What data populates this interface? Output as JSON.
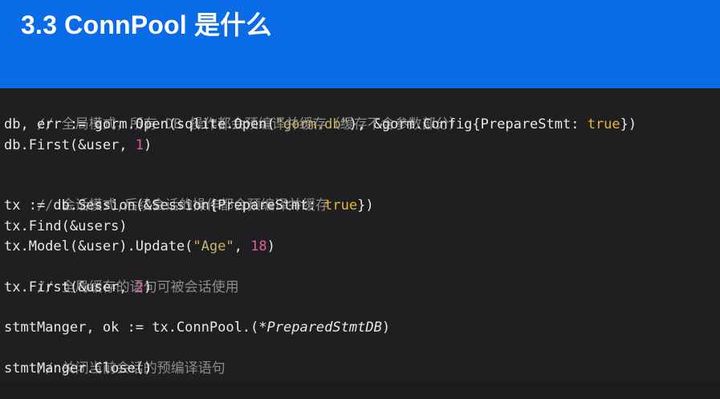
{
  "slide": {
    "title": "3.3 ConnPool 是什么"
  },
  "code": {
    "l1_comment": "// 全局模式，所有 DB 操作都会预编译并缓存（缓存不含参数部分）",
    "l2_a": "db, err := gorm.Open(sqlite.Open(",
    "l2_str": "\"gorm.db\"",
    "l2_b": "), &gorm.Config{PrepareStmt: ",
    "l2_kw": "true",
    "l2_c": "})",
    "l3_a": "db.First(&user, ",
    "l3_num": "1",
    "l3_b": ")",
    "l5_comment": "// 会话模式,后续会话的操作都会预编译并缓存",
    "l6_a": "tx := db.Session(&Session{PrepareStmt: ",
    "l6_kw": "true",
    "l6_b": "})",
    "l7": "tx.Find(&users)",
    "l8_a": "tx.Model(&user).Update(",
    "l8_str": "\"Age\"",
    "l8_b": ", ",
    "l8_num": "18",
    "l8_c": ")",
    "l9_comment": "// 全局缓存的语句可被会话使用",
    "l10_a": "tx.First(&user, ",
    "l10_num": "2",
    "l10_b": ")",
    "l12_a": "stmtManger, ok := tx.ConnPool.(",
    "l12_type": "*PreparedStmtDB",
    "l12_b": ")",
    "l13_comment": "// 关闭当前会话的预编译语句",
    "l14": "stmtManger.Close()"
  }
}
